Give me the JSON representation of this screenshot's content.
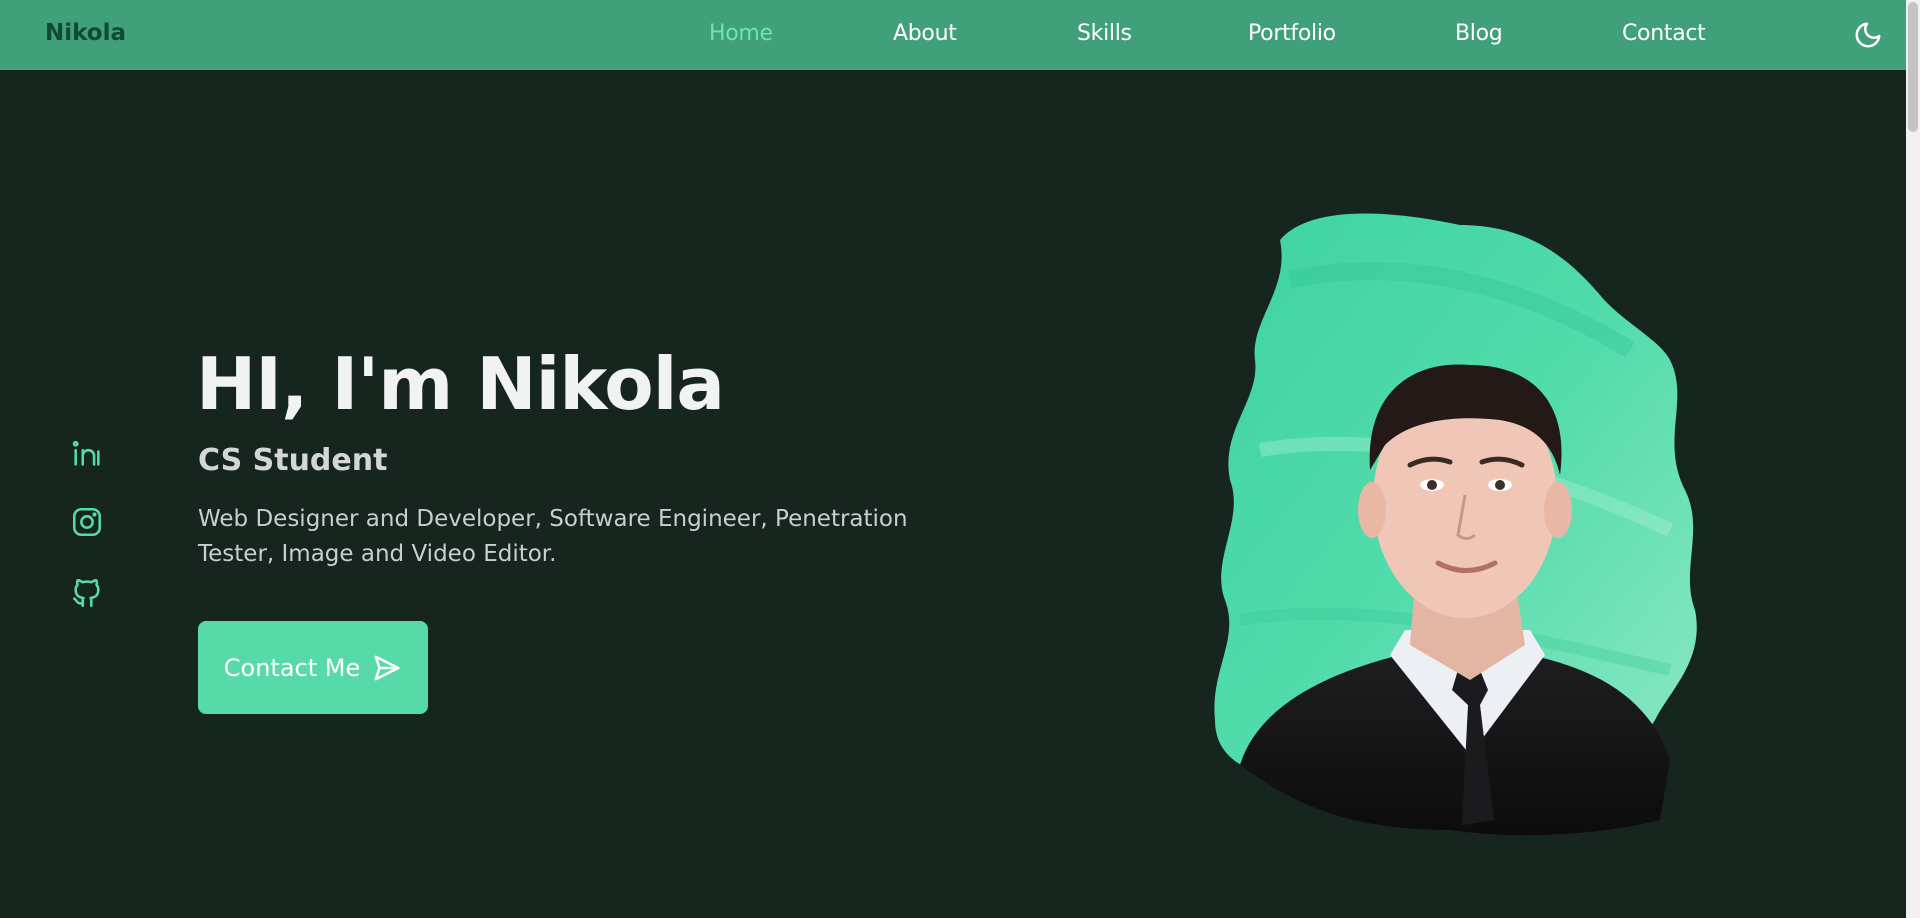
{
  "header": {
    "logo": "Nikola",
    "nav": [
      {
        "label": "Home",
        "active": true
      },
      {
        "label": "About",
        "active": false
      },
      {
        "label": "Skills",
        "active": false
      },
      {
        "label": "Portfolio",
        "active": false
      },
      {
        "label": "Blog",
        "active": false
      },
      {
        "label": "Contact",
        "active": false
      }
    ],
    "theme_toggle_icon": "moon-icon"
  },
  "social": [
    {
      "icon": "linkedin-icon"
    },
    {
      "icon": "instagram-icon"
    },
    {
      "icon": "github-icon"
    }
  ],
  "hero": {
    "title": "HI, I'm Nikola",
    "subtitle": "CS Student",
    "description": "Web Designer and Developer, Software Engineer, Penetration Tester, Image and Video Editor.",
    "button_label": "Contact Me",
    "button_icon": "send-icon"
  },
  "colors": {
    "header_bg": "#40a07a",
    "page_bg": "#17251f",
    "accent": "#56dba8",
    "active_nav": "#6ee3b4",
    "logo": "#0f4a33"
  }
}
